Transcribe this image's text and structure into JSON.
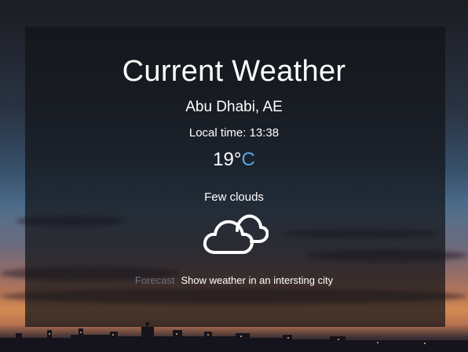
{
  "header": {
    "title": "Current Weather"
  },
  "weather": {
    "location": "Abu Dhabi, AE",
    "local_time": "Local time: 13:38",
    "temperature": "19°",
    "unit": "C",
    "description": "Few clouds",
    "icon": "few-clouds-icon"
  },
  "actions": {
    "forecast_label": "Forecast",
    "interesting_city_label": "Show weather in an intersting city"
  },
  "colors": {
    "unit_accent": "#5aa6e6",
    "panel_overlay": "rgba(18,19,24,0.72)",
    "muted_link": "#6f6f78"
  }
}
